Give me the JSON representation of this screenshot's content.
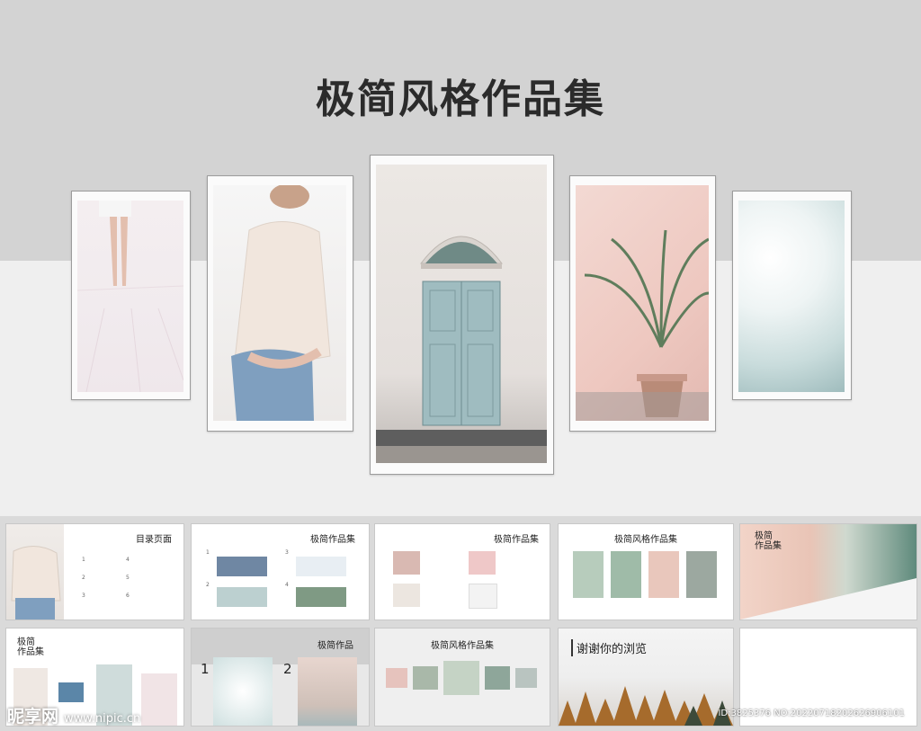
{
  "hero": {
    "title": "极简风格作品集"
  },
  "thumbnails": {
    "toc_title": "目录页面",
    "toc_numbers": [
      "1",
      "2",
      "3",
      "4",
      "5",
      "6"
    ],
    "slide2_title": "极简作品集",
    "slide2_numbers": [
      "1",
      "2",
      "3",
      "4"
    ],
    "slide3_title": "极简作品集",
    "slide4_title": "极简风格作品集",
    "slide5_title": "极简\n作品集",
    "slide6_title": "极简\n作品集",
    "slide7_title": "极简作品",
    "slide7_numbers": [
      "1",
      "2"
    ],
    "slide8_title": "极简风格作品集",
    "slide9_title": "谢谢你的浏览"
  },
  "watermark": {
    "site": "昵享网",
    "url": "www.nipic.cn",
    "id": "ID:3825376 NO:20220718202626906101"
  },
  "colors": {
    "hero_top": "#d3d3d3",
    "hero_bottom": "#efefef",
    "frame_border": "#9c9c9c",
    "strip_bg": "#dadada"
  }
}
